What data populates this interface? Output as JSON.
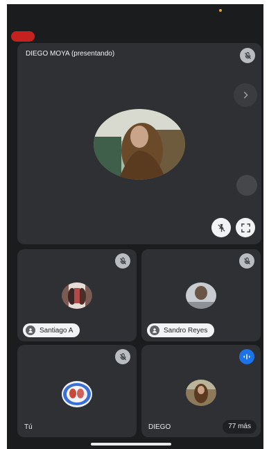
{
  "status": {
    "live_badge": ""
  },
  "presenter": {
    "name": "DIEGO MOYA (presentando)"
  },
  "participants": [
    {
      "name": "Santiago A",
      "muted": true
    },
    {
      "name": "Sandro Reyes",
      "muted": true
    }
  ],
  "self_tile": {
    "label": "Tú",
    "muted": true
  },
  "last_tile": {
    "label": "DIEGO",
    "more": "77 más",
    "speaking": true
  },
  "colors": {
    "background": "#1b1c1e",
    "tile": "#2e3034",
    "accent": "#1a73e8",
    "live": "#c5221f"
  },
  "icons": [
    "mic-off-icon",
    "chevron-right-icon",
    "pin-icon",
    "fullscreen-icon",
    "person-icon",
    "audio-wave-icon"
  ]
}
